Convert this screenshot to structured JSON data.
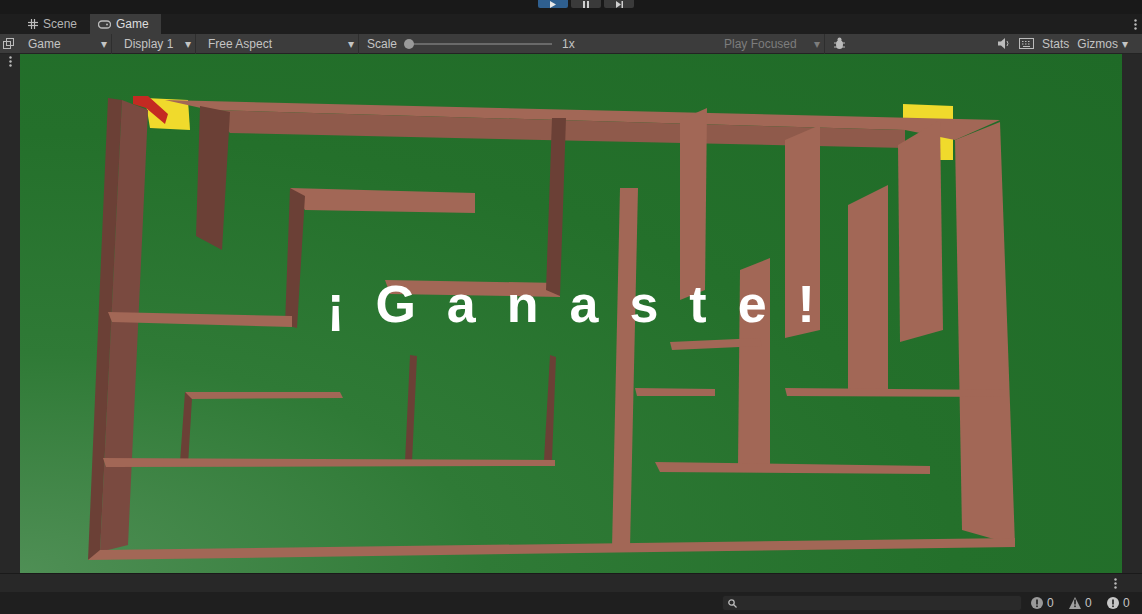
{
  "playmode": {
    "playing": true,
    "paused": false
  },
  "tabs": [
    {
      "label": "Scene",
      "selected": false
    },
    {
      "label": "Game",
      "selected": true
    }
  ],
  "toolbar": {
    "view": "Game",
    "display": "Display 1",
    "aspect": "Free Aspect",
    "scale_label": "Scale",
    "scale_level": 0,
    "scale_value": "1x",
    "play_focused": {
      "label": "Play Focused",
      "disabled": true
    },
    "stats": "Stats",
    "gizmos": "Gizmos"
  },
  "game": {
    "message": "¡Ganaste!"
  },
  "console_counts": [
    {
      "kind": "info",
      "count": "0"
    },
    {
      "kind": "warning",
      "count": "0"
    },
    {
      "kind": "error",
      "count": "0"
    }
  ]
}
